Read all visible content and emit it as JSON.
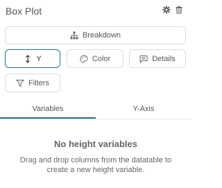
{
  "panel": {
    "title": "Box Plot",
    "icons": [
      "gear-icon",
      "trash-icon"
    ]
  },
  "buttons": {
    "breakdown": {
      "label": "Breakdown",
      "icon": "hierarchy-icon"
    },
    "y": {
      "label": "Y",
      "icon": "vertical-arrows-icon"
    },
    "color": {
      "label": "Color",
      "icon": "palette-icon"
    },
    "details": {
      "label": "Details",
      "icon": "comment-icon"
    },
    "filters": {
      "label": "Filters",
      "icon": "funnel-icon"
    }
  },
  "tabs": [
    {
      "label": "Variables",
      "selected": true
    },
    {
      "label": "Y-Axis",
      "selected": false
    }
  ],
  "empty_state": {
    "title": "No height variables",
    "description": "Drag and drop columns from the datatable to create a new height variable."
  },
  "colors": {
    "accent": "#2a6f8a",
    "text": "#555555",
    "border": "#dcdcdc"
  }
}
